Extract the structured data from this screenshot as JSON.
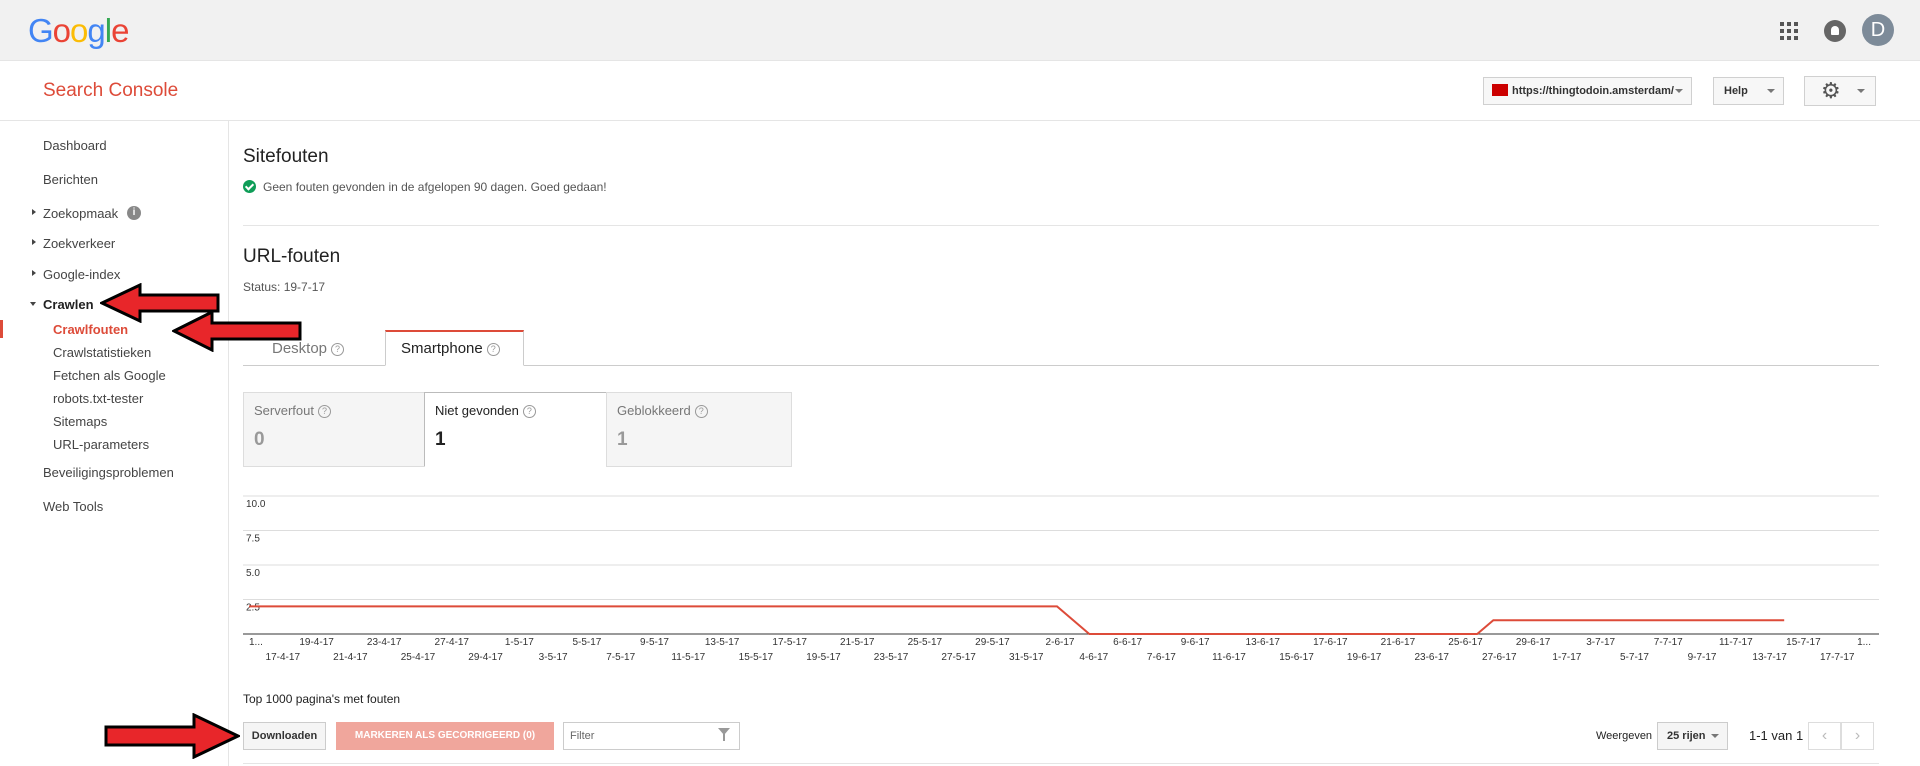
{
  "topbar": {
    "logo": "Google",
    "avatar_letter": "D"
  },
  "appbar": {
    "product": "Search Console",
    "property": "https://thingtodoin.amsterdam/",
    "help": "Help"
  },
  "sidebar": {
    "items": [
      {
        "label": "Dashboard"
      },
      {
        "label": "Berichten"
      },
      {
        "label": "Zoekopmaak"
      },
      {
        "label": "Zoekverkeer"
      },
      {
        "label": "Google-index"
      },
      {
        "label": "Crawlen"
      },
      {
        "label": "Beveiligingsproblemen"
      },
      {
        "label": "Web Tools"
      }
    ],
    "sub_items": [
      {
        "label": "Crawlfouten"
      },
      {
        "label": "Crawlstatistieken"
      },
      {
        "label": "Fetchen als Google"
      },
      {
        "label": "robots.txt-tester"
      },
      {
        "label": "Sitemaps"
      },
      {
        "label": "URL-parameters"
      }
    ]
  },
  "site_errors": {
    "title": "Sitefouten",
    "message": "Geen fouten gevonden in de afgelopen 90 dagen. Goed gedaan!"
  },
  "url_errors": {
    "title": "URL-fouten",
    "status": "Status: 19-7-17",
    "tabs": [
      {
        "label": "Desktop"
      },
      {
        "label": "Smartphone"
      }
    ],
    "cards": [
      {
        "label": "Serverfout",
        "value": "0"
      },
      {
        "label": "Niet gevonden",
        "value": "1"
      },
      {
        "label": "Geblokkeerd",
        "value": "1"
      }
    ]
  },
  "chart_data": {
    "type": "line",
    "y_ticks": [
      "10.0",
      "7.5",
      "5.0",
      "2.5"
    ],
    "ylim": [
      0,
      10
    ],
    "x_labels_top": [
      "1...",
      "19-4-17",
      "23-4-17",
      "27-4-17",
      "1-5-17",
      "5-5-17",
      "9-5-17",
      "13-5-17",
      "17-5-17",
      "21-5-17",
      "25-5-17",
      "29-5-17",
      "2-6-17",
      "6-6-17",
      "9-6-17",
      "13-6-17",
      "17-6-17",
      "21-6-17",
      "25-6-17",
      "29-6-17",
      "3-7-17",
      "7-7-17",
      "11-7-17",
      "15-7-17",
      "1..."
    ],
    "x_labels_bottom": [
      "17-4-17",
      "21-4-17",
      "25-4-17",
      "29-4-17",
      "3-5-17",
      "7-5-17",
      "11-5-17",
      "15-5-17",
      "19-5-17",
      "23-5-17",
      "27-5-17",
      "31-5-17",
      "4-6-17",
      "7-6-17",
      "11-6-17",
      "15-6-17",
      "19-6-17",
      "23-6-17",
      "27-6-17",
      "1-7-17",
      "5-7-17",
      "9-7-17",
      "13-7-17",
      "17-7-17"
    ],
    "series": [
      {
        "color": "#dd4b39",
        "points": [
          [
            0,
            2
          ],
          [
            50,
            2
          ],
          [
            52,
            0
          ],
          [
            76,
            0
          ],
          [
            77,
            1
          ],
          [
            95,
            1
          ]
        ]
      }
    ]
  },
  "table_controls": {
    "heading": "Top 1000 pagina's met fouten",
    "download": "Downloaden",
    "mark_fixed": "MARKEREN ALS GECORRIGEERD (0)",
    "filter_placeholder": "Filter",
    "show": "Weergeven",
    "rows": "25 rijen",
    "page_info": "1-1 van 1"
  }
}
